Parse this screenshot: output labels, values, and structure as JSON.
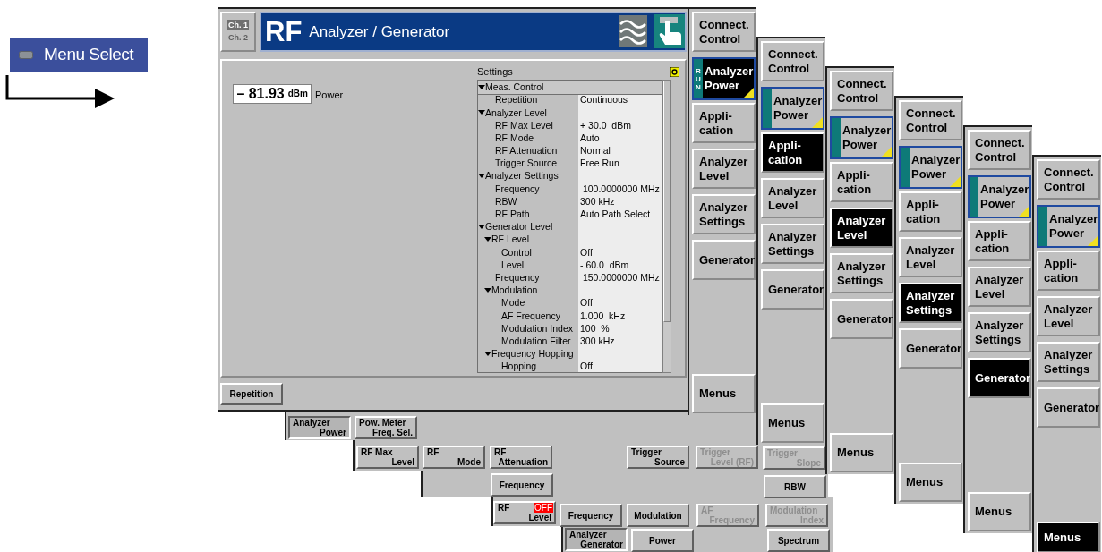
{
  "menu_select": {
    "label": "Menu Select"
  },
  "window": {
    "channels": [
      {
        "label": "Ch. 1",
        "selected": true
      },
      {
        "label": "Ch. 2",
        "selected": false
      }
    ],
    "title_prefix": "RF",
    "title": "Analyzer / Generator"
  },
  "readout": {
    "value": "– 81.93",
    "unit": "dBm",
    "label": "Power"
  },
  "settings": {
    "title": "Settings",
    "rows": [
      {
        "label": "Meas. Control",
        "selected": true,
        "expanded": true,
        "children": [
          {
            "label": "Repetition",
            "value": "Continuous",
            "selected": false
          }
        ]
      },
      {
        "label": "Analyzer Level",
        "selected": false,
        "expanded": true,
        "children": [
          {
            "label": "RF Max Level",
            "value": "+ 30.0  dBm",
            "selected": false
          },
          {
            "label": "RF Mode",
            "value": "Auto",
            "selected": false
          },
          {
            "label": "RF Attenuation",
            "value": "Normal",
            "selected": false
          },
          {
            "label": "Trigger Source",
            "value": "Free Run",
            "selected": false
          }
        ]
      },
      {
        "label": "Analyzer Settings",
        "selected": false,
        "expanded": true,
        "children": [
          {
            "label": "Frequency",
            "value": " 100.0000000 MHz",
            "selected": false
          },
          {
            "label": "RBW",
            "value": "300 kHz",
            "selected": false
          },
          {
            "label": "RF Path",
            "value": "Auto Path Select",
            "selected": false
          }
        ]
      },
      {
        "label": "Generator Level",
        "selected": false,
        "expanded": true,
        "children": [
          {
            "label": "RF Level",
            "selected": false,
            "expanded": true,
            "children": [
              {
                "label": "Control",
                "value": "Off",
                "selected": false
              },
              {
                "label": "Level",
                "value": "- 60.0  dBm",
                "selected": false
              }
            ]
          },
          {
            "label": "Frequency",
            "value": " 150.0000000 MHz",
            "selected": false
          },
          {
            "label": "Modulation",
            "selected": false,
            "expanded": true,
            "children": [
              {
                "label": "Mode",
                "value": "Off",
                "selected": false
              },
              {
                "label": "AF Frequency",
                "value": "1.000  kHz",
                "selected": false
              },
              {
                "label": "Modulation Index",
                "value": "100  %",
                "selected": false
              },
              {
                "label": "Modulation Filter",
                "value": "300 kHz",
                "selected": false
              }
            ]
          },
          {
            "label": "Frequency Hopping",
            "selected": false,
            "expanded": true,
            "children": [
              {
                "label": "Hopping",
                "value": "Off",
                "selected": false
              }
            ]
          }
        ]
      }
    ]
  },
  "repetition_key": {
    "label": "Repetition"
  },
  "columns": [
    {
      "items": [
        {
          "kind": "plain",
          "lines": [
            "Connect.",
            "Control"
          ],
          "selected": false
        },
        {
          "kind": "run",
          "run_tag": "RUN",
          "lines": [
            "Analyzer",
            "Power"
          ],
          "selected": true
        },
        {
          "kind": "plain",
          "lines": [
            "Appli-",
            "cation"
          ],
          "selected": false
        },
        {
          "kind": "plain",
          "lines": [
            "Analyzer",
            "Level"
          ],
          "selected": false
        },
        {
          "kind": "plain",
          "lines": [
            "Analyzer",
            "Settings"
          ],
          "selected": false
        },
        {
          "kind": "plain",
          "lines": [
            "Generator"
          ],
          "selected": false
        },
        {
          "kind": "menus",
          "lines": [
            "Menus"
          ],
          "selected": false
        }
      ]
    },
    {
      "items": [
        {
          "kind": "plain",
          "lines": [
            "Connect.",
            "Control"
          ],
          "selected": false
        },
        {
          "kind": "run",
          "lines": [
            "Analyzer",
            "Power"
          ],
          "selected": false
        },
        {
          "kind": "plain",
          "lines": [
            "Appli-",
            "cation"
          ],
          "selected": true
        },
        {
          "kind": "plain",
          "lines": [
            "Analyzer",
            "Level"
          ],
          "selected": false
        },
        {
          "kind": "plain",
          "lines": [
            "Analyzer",
            "Settings"
          ],
          "selected": false
        },
        {
          "kind": "plain",
          "lines": [
            "Generator"
          ],
          "selected": false
        },
        {
          "kind": "menus",
          "lines": [
            "Menus"
          ],
          "selected": false
        }
      ]
    },
    {
      "items": [
        {
          "kind": "plain",
          "lines": [
            "Connect.",
            "Control"
          ],
          "selected": false
        },
        {
          "kind": "run",
          "lines": [
            "Analyzer",
            "Power"
          ],
          "selected": false
        },
        {
          "kind": "plain",
          "lines": [
            "Appli-",
            "cation"
          ],
          "selected": false
        },
        {
          "kind": "plain",
          "lines": [
            "Analyzer",
            "Level"
          ],
          "selected": true
        },
        {
          "kind": "plain",
          "lines": [
            "Analyzer",
            "Settings"
          ],
          "selected": false
        },
        {
          "kind": "plain",
          "lines": [
            "Generator"
          ],
          "selected": false
        },
        {
          "kind": "menus",
          "lines": [
            "Menus"
          ],
          "selected": false
        }
      ]
    },
    {
      "items": [
        {
          "kind": "plain",
          "lines": [
            "Connect.",
            "Control"
          ],
          "selected": false
        },
        {
          "kind": "run",
          "lines": [
            "Analyzer",
            "Power"
          ],
          "selected": false
        },
        {
          "kind": "plain",
          "lines": [
            "Appli-",
            "cation"
          ],
          "selected": false
        },
        {
          "kind": "plain",
          "lines": [
            "Analyzer",
            "Level"
          ],
          "selected": false
        },
        {
          "kind": "plain",
          "lines": [
            "Analyzer",
            "Settings"
          ],
          "selected": true
        },
        {
          "kind": "plain",
          "lines": [
            "Generator"
          ],
          "selected": false
        },
        {
          "kind": "menus",
          "lines": [
            "Menus"
          ],
          "selected": false
        }
      ]
    },
    {
      "items": [
        {
          "kind": "plain",
          "lines": [
            "Connect.",
            "Control"
          ],
          "selected": false
        },
        {
          "kind": "run",
          "lines": [
            "Analyzer",
            "Power"
          ],
          "selected": false
        },
        {
          "kind": "plain",
          "lines": [
            "Appli-",
            "cation"
          ],
          "selected": false
        },
        {
          "kind": "plain",
          "lines": [
            "Analyzer",
            "Level"
          ],
          "selected": false
        },
        {
          "kind": "plain",
          "lines": [
            "Analyzer",
            "Settings"
          ],
          "selected": false
        },
        {
          "kind": "plain",
          "lines": [
            "Generator"
          ],
          "selected": true
        },
        {
          "kind": "menus",
          "lines": [
            "Menus"
          ],
          "selected": false
        }
      ]
    },
    {
      "items": [
        {
          "kind": "plain",
          "lines": [
            "Connect.",
            "Control"
          ],
          "selected": false
        },
        {
          "kind": "run",
          "lines": [
            "Analyzer",
            "Power"
          ],
          "selected": false
        },
        {
          "kind": "plain",
          "lines": [
            "Appli-",
            "cation"
          ],
          "selected": false
        },
        {
          "kind": "plain",
          "lines": [
            "Analyzer",
            "Level"
          ],
          "selected": false
        },
        {
          "kind": "plain",
          "lines": [
            "Analyzer",
            "Settings"
          ],
          "selected": false
        },
        {
          "kind": "plain",
          "lines": [
            "Generator"
          ],
          "selected": false
        },
        {
          "kind": "menus",
          "lines": [
            "Menus"
          ],
          "selected": true
        }
      ]
    }
  ],
  "softkey_rows": [
    {
      "keys": [
        {
          "lines": [
            "Analyzer",
            "Power"
          ],
          "selected": true,
          "disabled": false
        },
        {
          "lines": [
            "Pow. Meter",
            "Freq. Sel."
          ],
          "selected": false,
          "disabled": false
        }
      ]
    },
    {
      "keys": [
        {
          "lines": [
            "RF Max",
            "Level"
          ],
          "selected": false,
          "disabled": false
        },
        {
          "lines": [
            "RF",
            "Mode"
          ],
          "selected": false,
          "disabled": false
        },
        {
          "lines": [
            "RF",
            "Attenuation"
          ],
          "selected": false,
          "disabled": false
        },
        {
          "lines": [
            "Trigger",
            "Source"
          ],
          "selected": false,
          "disabled": false
        },
        {
          "lines": [
            "Trigger",
            "Level (RF)"
          ],
          "selected": false,
          "disabled": true
        },
        {
          "lines": [
            "Trigger",
            "Slope"
          ],
          "selected": false,
          "disabled": true
        }
      ]
    },
    {
      "keys": [
        {
          "lines": [
            "Frequency"
          ],
          "selected": false,
          "disabled": false
        },
        {
          "lines": [
            "RBW"
          ],
          "selected": false,
          "disabled": false
        }
      ]
    },
    {
      "keys": [
        {
          "lines": [
            "RF",
            "Level"
          ],
          "badge": "OFF",
          "selected": false,
          "disabled": false
        },
        {
          "lines": [
            "Frequency"
          ],
          "selected": false,
          "disabled": false
        },
        {
          "lines": [
            "Modulation"
          ],
          "selected": false,
          "disabled": false
        },
        {
          "lines": [
            "AF",
            "Frequency"
          ],
          "selected": false,
          "disabled": true
        },
        {
          "lines": [
            "Modulation",
            "Index"
          ],
          "selected": false,
          "disabled": true
        }
      ]
    },
    {
      "keys": [
        {
          "lines": [
            "Analyzer",
            "Generator"
          ],
          "selected": true,
          "disabled": false
        },
        {
          "lines": [
            "Power"
          ],
          "selected": false,
          "disabled": false
        },
        {
          "lines": [
            "Spectrum"
          ],
          "selected": false,
          "disabled": false
        }
      ]
    }
  ]
}
